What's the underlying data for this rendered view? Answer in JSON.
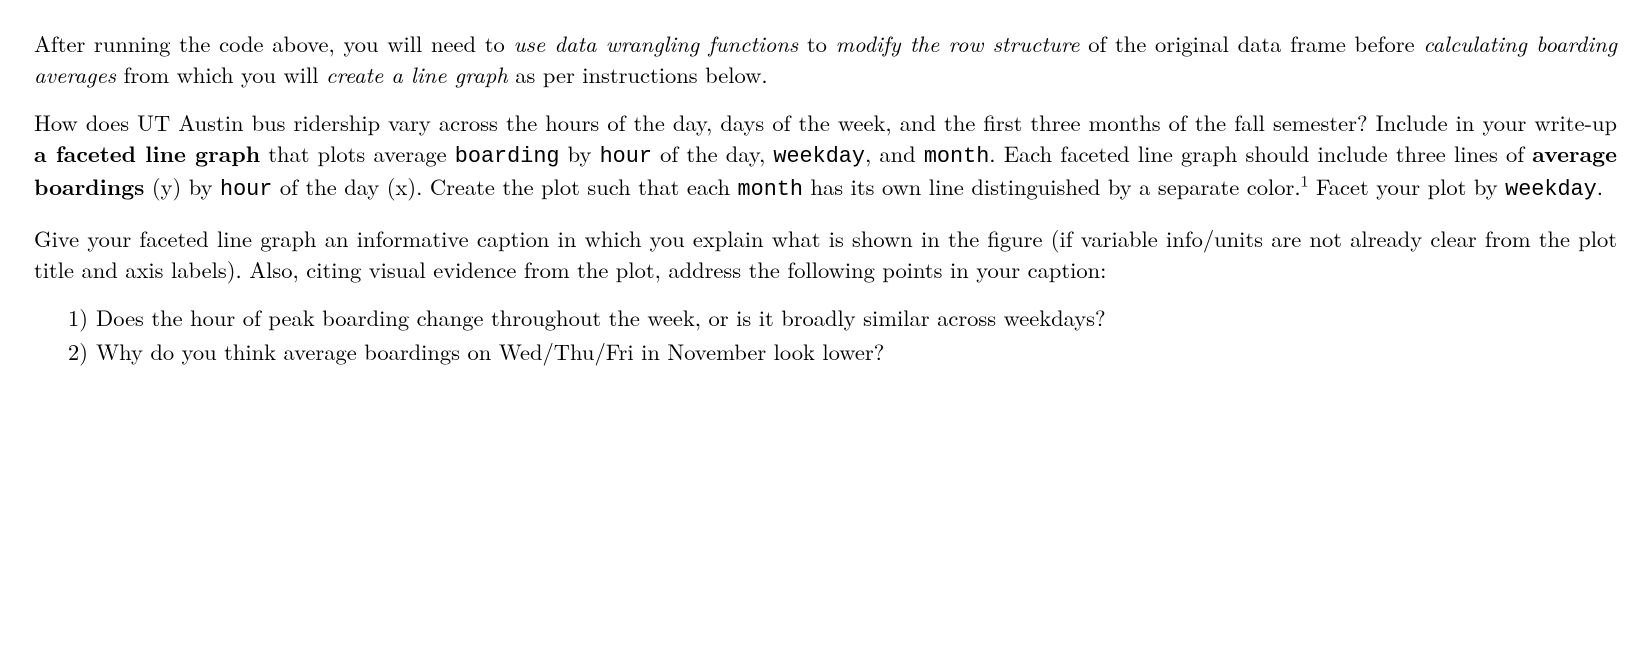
{
  "p1": {
    "t1": "After running the code above, you will need to ",
    "i1": "use data wrangling functions",
    "t2": " to ",
    "i2": "modify the row structure",
    "t3": " of the original data frame before ",
    "i3": "calculating boarding averages",
    "t4": " from which you will ",
    "i4": "create a line graph",
    "t5": " as per instructions below."
  },
  "p2": {
    "t1": "How does UT Austin bus ridership vary across the hours of the day, days of the week, and the first three months of the fall semester? Include in your write-up ",
    "b1": "a faceted line graph",
    "t2": " that plots average ",
    "tt1": "boarding",
    "t3": " by ",
    "tt2": "hour",
    "t4": " of the day, ",
    "tt3": "weekday",
    "t5": ", and ",
    "tt4": "month",
    "t6": ". Each faceted line graph should include three lines of ",
    "b2": "average boardings",
    "t7": " (y) by ",
    "tt5": "hour",
    "t8": " of the day (x). Create the plot such that each ",
    "tt6": "month",
    "t9": " has its own line distinguished by a separate color.",
    "fn": "1",
    "t10": " Facet your plot by ",
    "tt7": "weekday",
    "t11": "."
  },
  "p3": {
    "t1": "Give your faceted line graph an informative caption in which you explain what is shown in the figure (if variable info/units are not already clear from the plot title and axis labels). Also, citing visual evidence from the plot, address the following points in your caption:"
  },
  "list": {
    "n1": "1)",
    "q1": "Does the hour of peak boarding change throughout the week, or is it broadly similar across weekdays?",
    "n2": "2)",
    "q2": "Why do you think average boardings on Wed/Thu/Fri in November look lower?"
  }
}
